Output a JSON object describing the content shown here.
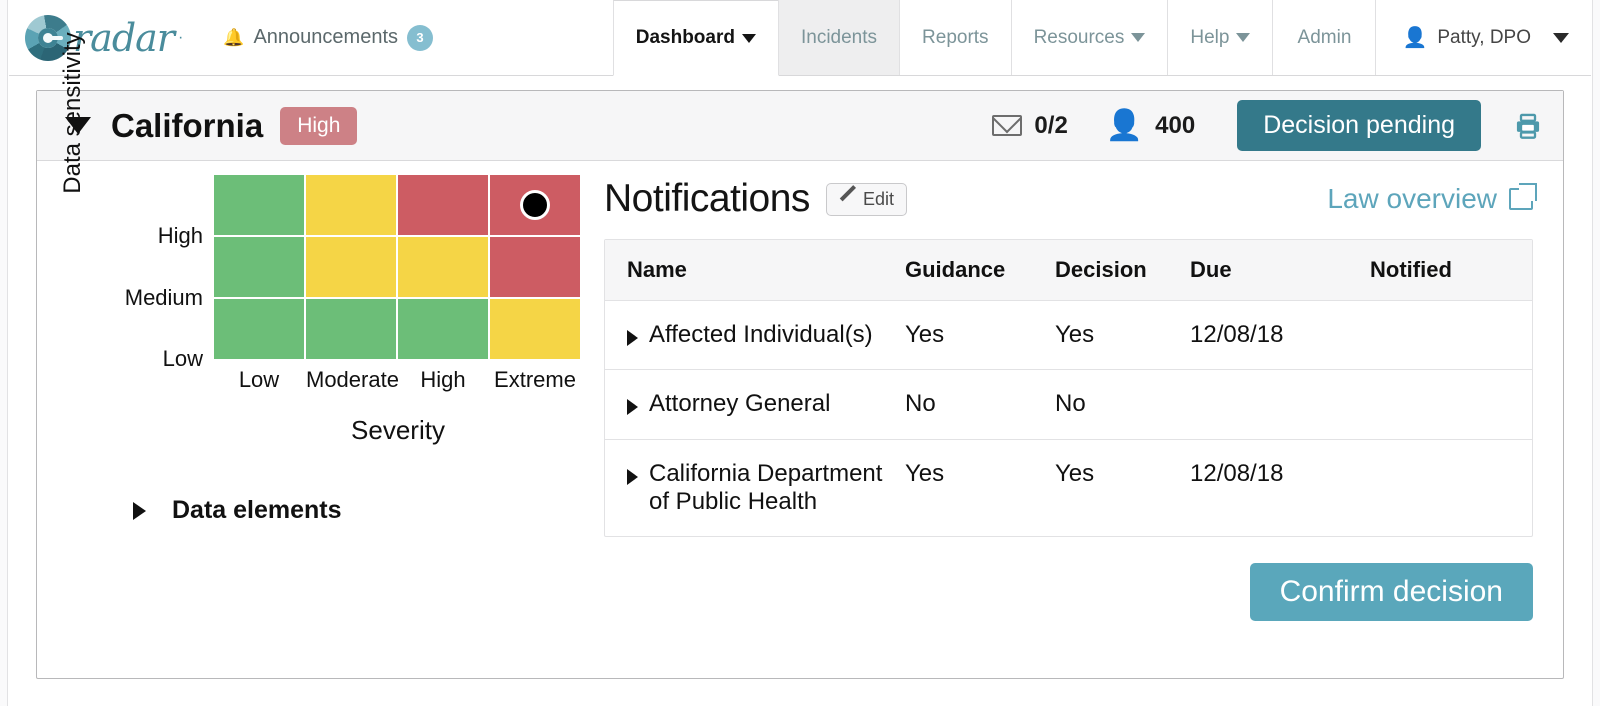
{
  "topnav": {
    "brand": {
      "word": "radar",
      "trademark": "·",
      "logo_icon": "radar-logo-icon"
    },
    "announcements": {
      "icon": "bell-icon",
      "label": "Announcements",
      "count": "3"
    },
    "tabs": [
      {
        "label": "Dashboard",
        "has_caret": true,
        "active": true,
        "shaded": false
      },
      {
        "label": "Incidents",
        "has_caret": false,
        "active": false,
        "shaded": true
      },
      {
        "label": "Reports",
        "has_caret": false,
        "active": false,
        "shaded": false
      },
      {
        "label": "Resources",
        "has_caret": true,
        "active": false,
        "shaded": false
      },
      {
        "label": "Help",
        "has_caret": true,
        "active": false,
        "shaded": false
      },
      {
        "label": "Admin",
        "has_caret": false,
        "active": false,
        "shaded": false
      }
    ],
    "user": {
      "icon": "user-icon",
      "name": "Patty, DPO",
      "caret": "chevron-down-icon"
    }
  },
  "card": {
    "header": {
      "collapse_icon": "triangle-down-icon",
      "title": "California",
      "risk_badge": "High",
      "risk_badge_color": "#cd8186",
      "stats": [
        {
          "icon": "envelope-icon",
          "value": "0/2"
        },
        {
          "icon": "person-icon",
          "value": "400"
        }
      ],
      "status": "Decision pending",
      "status_color": "#34798a",
      "print_icon": "printer-icon"
    },
    "data_elements": {
      "caret": "triangle-right-icon",
      "label": "Data elements"
    },
    "notifications": {
      "title": "Notifications",
      "edit_label": "Edit",
      "edit_icon": "pencil-icon",
      "law_link": "Law overview",
      "law_link_icon": "external-link-icon",
      "law_link_color": "#5da5bb",
      "columns": [
        "Name",
        "Guidance",
        "Decision",
        "Due",
        "Notified"
      ],
      "rows": [
        {
          "name": "Affected Individual(s)",
          "guidance": "Yes",
          "decision": "Yes",
          "due": "12/08/18",
          "notified": ""
        },
        {
          "name": "Attorney General",
          "guidance": "No",
          "decision": "No",
          "due": "",
          "notified": ""
        },
        {
          "name": "California Department\nof Public Health",
          "guidance": "Yes",
          "decision": "Yes",
          "due": "12/08/18",
          "notified": ""
        }
      ],
      "confirm_label": "Confirm decision",
      "confirm_color": "#5aa7bb"
    }
  },
  "chart_data": {
    "type": "heatmap",
    "title": "",
    "xlabel": "Severity",
    "ylabel": "Data sensitivity",
    "x_categories": [
      "Low",
      "Moderate",
      "High",
      "Extreme"
    ],
    "y_categories": [
      "High",
      "Medium",
      "Low"
    ],
    "grid": true,
    "legend": "none",
    "colors": {
      "green": "#6cbe78",
      "yellow": "#f5d546",
      "red": "#cd5c63"
    },
    "cells": [
      [
        "green",
        "yellow",
        "red",
        "red"
      ],
      [
        "green",
        "yellow",
        "yellow",
        "red"
      ],
      [
        "green",
        "green",
        "green",
        "yellow"
      ]
    ],
    "marker": {
      "row": 0,
      "col": 3,
      "x": "Extreme",
      "y": "High",
      "color": "#000000",
      "label": "current-risk-position"
    }
  }
}
